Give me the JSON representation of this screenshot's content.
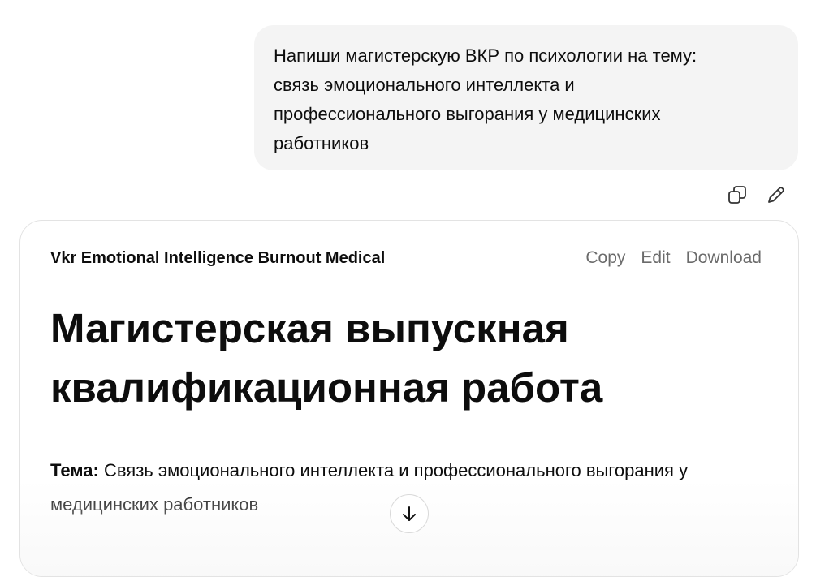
{
  "user_message": {
    "lines": [
      "Напиши магистерскую ВКР по психологии на тему:",
      "связь эмоционального интеллекта и",
      "профессионального выгорания у медицинских",
      "работников"
    ]
  },
  "message_actions": {
    "copy_icon": "copy-icon",
    "edit_icon": "pencil-icon"
  },
  "canvas": {
    "doc_name": "Vkr Emotional Intelligence Burnout Medical",
    "actions": {
      "copy": "Copy",
      "edit": "Edit",
      "download": "Download"
    },
    "title_lines": [
      "Магистерская выпускная",
      "квалификационная работа"
    ],
    "topic_label": "Тема:",
    "topic_text": " Связь эмоционального интеллекта и профессионального выгорания у",
    "topic_text_cont": "медицинских работников"
  },
  "scroll_button": {
    "icon": "arrow-down-icon"
  }
}
